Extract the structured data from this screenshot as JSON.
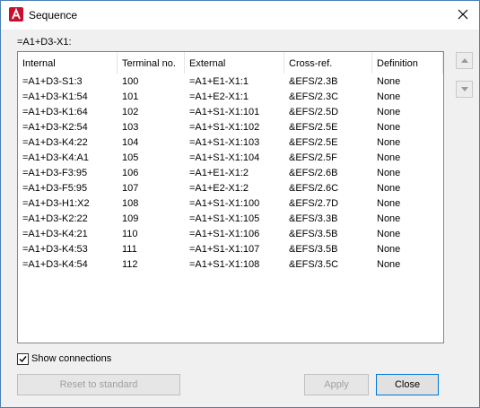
{
  "window": {
    "title": "Sequence"
  },
  "path_label": "=A1+D3-X1:",
  "columns": [
    "Internal",
    "Terminal no.",
    "External",
    "Cross-ref.",
    "Definition"
  ],
  "rows": [
    [
      "=A1+D3-S1:3",
      "100",
      "=A1+E1-X1:1",
      "&EFS/2.3B",
      "None"
    ],
    [
      "=A1+D3-K1:54",
      "101",
      "=A1+E2-X1:1",
      "&EFS/2.3C",
      "None"
    ],
    [
      "=A1+D3-K1:64",
      "102",
      "=A1+S1-X1:101",
      "&EFS/2.5D",
      "None"
    ],
    [
      "=A1+D3-K2:54",
      "103",
      "=A1+S1-X1:102",
      "&EFS/2.5E",
      "None"
    ],
    [
      "=A1+D3-K4:22",
      "104",
      "=A1+S1-X1:103",
      "&EFS/2.5E",
      "None"
    ],
    [
      "=A1+D3-K4:A1",
      "105",
      "=A1+S1-X1:104",
      "&EFS/2.5F",
      "None"
    ],
    [
      "=A1+D3-F3:95",
      "106",
      "=A1+E1-X1:2",
      "&EFS/2.6B",
      "None"
    ],
    [
      "=A1+D3-F5:95",
      "107",
      "=A1+E2-X1:2",
      "&EFS/2.6C",
      "None"
    ],
    [
      "=A1+D3-H1:X2",
      "108",
      "=A1+S1-X1:100",
      "&EFS/2.7D",
      "None"
    ],
    [
      "=A1+D3-K2:22",
      "109",
      "=A1+S1-X1:105",
      "&EFS/3.3B",
      "None"
    ],
    [
      "=A1+D3-K4:21",
      "110",
      "=A1+S1-X1:106",
      "&EFS/3.5B",
      "None"
    ],
    [
      "=A1+D3-K4:53",
      "111",
      "=A1+S1-X1:107",
      "&EFS/3.5B",
      "None"
    ],
    [
      "=A1+D3-K4:54",
      "112",
      "=A1+S1-X1:108",
      "&EFS/3.5C",
      "None"
    ]
  ],
  "show_connections": {
    "label": "Show connections",
    "checked": true
  },
  "buttons": {
    "reset": "Reset to standard",
    "apply": "Apply",
    "close": "Close"
  },
  "icons": {
    "app": "autodesk-app-icon",
    "close": "close-icon",
    "move_up": "arrow-up-icon",
    "move_down": "arrow-down-icon"
  },
  "colors": {
    "app_icon": "#c8102e",
    "window_border": "#4a7fb8",
    "default_button": "#0078d7"
  }
}
